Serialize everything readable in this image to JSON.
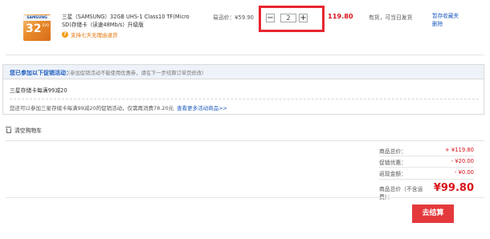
{
  "item": {
    "thumb_brand": "SAMSUNG",
    "thumb_capacity": "32",
    "thumb_evo": "EVO",
    "name": "三星（SAMSUNG）32GB UHS-1 Class10 TF(Micro SD)存储卡（读速48Mb/s）升级版",
    "promo_badge": "7",
    "promo_text": "支持七天无理由退货",
    "price": "易迅价：¥59.90",
    "quantity": "2",
    "qty_minus": "−",
    "qty_plus": "+",
    "subtotal": "119.80",
    "stock": "有货，可当日发货",
    "op_save": "暂存收藏夹",
    "op_delete": "删除"
  },
  "promotion": {
    "title": "您已参加以下促销活动：",
    "note": "（参加促销活动不能使用优惠券，请在下一步结算订单页修改）",
    "rule": "三星存储卡每满99减20",
    "tip": "您还可以参加三星存储卡每满99减20的促销活动，仅需再消费78.20元",
    "tip_link": "查看更多活动商品>>"
  },
  "cart": {
    "clear_label": "清空购物车"
  },
  "summary": {
    "goods_label": "商品总价：",
    "goods_value": "+ ¥119.80",
    "discount_label": "促销优惠：",
    "discount_value": "- ¥20.00",
    "return_label": "返现金额：",
    "return_value": "- ¥0.00",
    "total_label": "商品总价（不含运费）：",
    "total_value": "¥99.80"
  },
  "checkout_label": "去结算",
  "colors": {
    "accent_red": "#d9141c",
    "link_blue": "#1c5bbf",
    "highlight_border": "#e8252f"
  }
}
